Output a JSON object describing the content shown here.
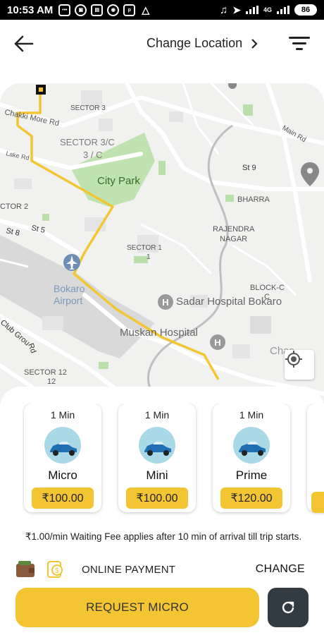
{
  "status_bar": {
    "time": "10:53 AM",
    "battery": "86",
    "network": "4G"
  },
  "header": {
    "title": "Change Location"
  },
  "map": {
    "labels": {
      "chakki": "Chakki More Rd",
      "sector3": "SECTOR 3",
      "sector3c_a": "SECTOR 3/C",
      "sector3c_b": "3 / C",
      "main_rd": "Main Rd",
      "lake_rd": "Lake Rd",
      "city_park": "City Park",
      "st9": "St 9",
      "bharra": "BHARRA",
      "sector2": "CTOR 2",
      "st5": "St 5",
      "st8": "St 8",
      "rajendra_a": "RAJENDRA",
      "rajendra_b": "NAGAR",
      "sector1_a": "SECTOR 1",
      "sector1_b": "1",
      "airport_a": "Bokaro",
      "airport_b": "Airport",
      "blockc_a": "BLOCK-C",
      "blockc_b": "C",
      "sadar": "Sadar Hospital Bokaro",
      "club": "Club Grou",
      "rd": "Rd",
      "muskan": "Muskan Hospital",
      "chas": "Chas",
      "sector12_a": "SECTOR 12",
      "sector12_b": "12"
    }
  },
  "rides": [
    {
      "eta": "1 Min",
      "name": "Micro",
      "price": "₹100.00"
    },
    {
      "eta": "1 Min",
      "name": "Mini",
      "price": "₹100.00"
    },
    {
      "eta": "1 Min",
      "name": "Prime",
      "price": "₹120.00"
    }
  ],
  "waiting_fee": "₹1.00/min Waiting Fee applies after 10 min of arrival till trip starts.",
  "payment": {
    "label": "ONLINE PAYMENT",
    "change": "CHANGE"
  },
  "request_button": "REQUEST MICRO",
  "colors": {
    "accent": "#f4c532",
    "dark_button": "#333b42",
    "route": "#f4c532"
  }
}
